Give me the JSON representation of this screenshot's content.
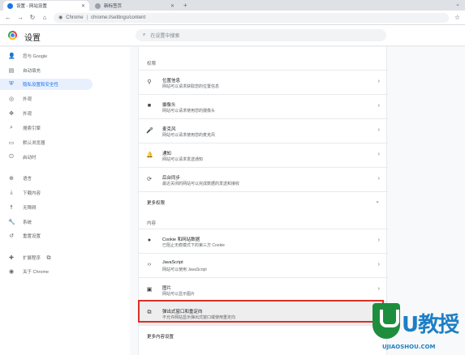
{
  "tabs": [
    {
      "label": "设置 - 网站设置",
      "active": true
    },
    {
      "label": "新标签页",
      "active": false
    }
  ],
  "omnibox": {
    "site": "Chrome",
    "path": "chrome://settings/content"
  },
  "header": {
    "title": "设置",
    "search_placeholder": "在设置中搜索"
  },
  "sidebar": {
    "items": [
      {
        "icon": "person-icon",
        "glyph": "👤",
        "label": "您与 Google"
      },
      {
        "icon": "autofill-icon",
        "glyph": "▤",
        "label": "自动填充"
      },
      {
        "icon": "shield-icon",
        "glyph": "⛨",
        "label": "隐私设置和安全性",
        "active": true
      },
      {
        "icon": "appearance-icon",
        "glyph": "◎",
        "label": "外观"
      },
      {
        "icon": "puzzle-icon",
        "glyph": "✥",
        "label": "外观"
      },
      {
        "icon": "search-icon",
        "glyph": "⌕",
        "label": "搜索引擎"
      },
      {
        "icon": "browser-icon",
        "glyph": "▭",
        "label": "默认浏览器"
      },
      {
        "icon": "power-icon",
        "glyph": "⏻",
        "label": "启动时"
      },
      {
        "icon": "globe-icon",
        "glyph": "⊕",
        "label": "语言"
      },
      {
        "icon": "download-icon",
        "glyph": "⤓",
        "label": "下载内容"
      },
      {
        "icon": "accessibility-icon",
        "glyph": "☨",
        "label": "无障碍"
      },
      {
        "icon": "wrench-icon",
        "glyph": "🔧",
        "label": "系统"
      },
      {
        "icon": "reset-icon",
        "glyph": "↺",
        "label": "重置设置"
      },
      {
        "icon": "extension-icon",
        "glyph": "✚",
        "label": "扩展程序"
      },
      {
        "icon": "chrome-icon",
        "glyph": "◉",
        "label": "关于 Chrome"
      }
    ],
    "ext_link_glyph": "⧉"
  },
  "content": {
    "permissions_label": "权限",
    "permissions": [
      {
        "icon": "location-icon",
        "glyph": "⚲",
        "title": "位置信息",
        "desc": "网站可以请求获取您的位置信息"
      },
      {
        "icon": "camera-icon",
        "glyph": "■",
        "title": "摄像头",
        "desc": "网站可以请求使用您的摄像头"
      },
      {
        "icon": "mic-icon",
        "glyph": "🎤",
        "title": "麦克风",
        "desc": "网站可以请求使用您的麦克风"
      },
      {
        "icon": "bell-icon",
        "glyph": "🔔",
        "title": "通知",
        "desc": "网站可以请求发送通知"
      },
      {
        "icon": "sync-icon",
        "glyph": "⟳",
        "title": "后台同步",
        "desc": "最近关闭的网站可以完成数据的发送和接收"
      }
    ],
    "more_permissions": "更多权限",
    "content_label": "内容",
    "content_rows": [
      {
        "icon": "cookie-icon",
        "glyph": "●",
        "title": "Cookie 和网站数据",
        "desc": "已阻止无痕模式下的第三方 Cookie"
      },
      {
        "icon": "code-icon",
        "glyph": "‹›",
        "title": "JavaScript",
        "desc": "网站可以使用 JavaScript"
      },
      {
        "icon": "image-icon",
        "glyph": "▣",
        "title": "图片",
        "desc": "网站可以显示图片"
      },
      {
        "icon": "popup-icon",
        "glyph": "⧉",
        "title": "弹出式窗口和重定向",
        "desc": "不允许网站显示弹出式窗口或使用重定向",
        "highlight": true
      }
    ],
    "more_content": "更多内容设置",
    "arrow": "›",
    "expand": "⌄"
  },
  "watermark": {
    "brand": "U教授",
    "url": "UJIAOSHOU.COM"
  },
  "colors": {
    "accent": "#1a73e8",
    "highlight_border": "#d93025",
    "watermark_green": "#1e8e3e",
    "watermark_blue": "#1e7fc6"
  }
}
